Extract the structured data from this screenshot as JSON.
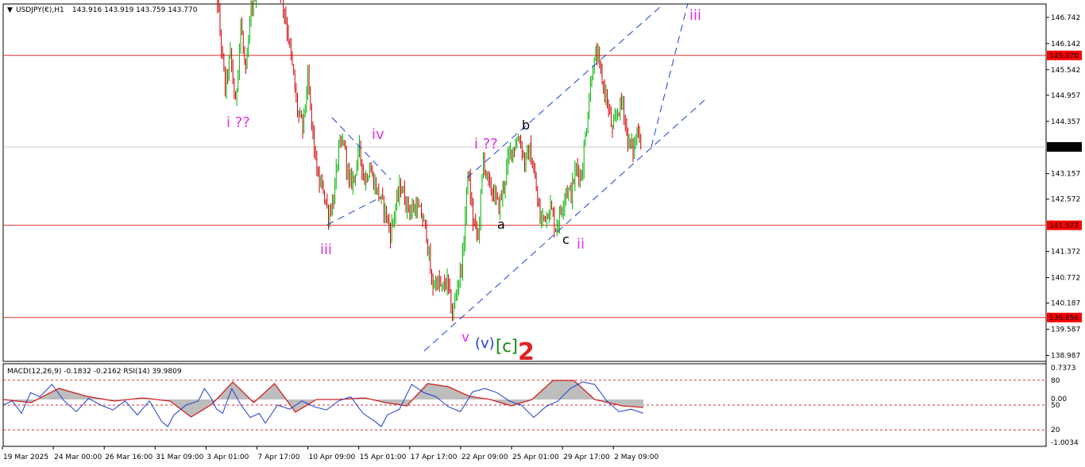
{
  "header": {
    "symbol": "USDJPY(€),H1",
    "ohlc": "143.916 143.919 143.759 143.770",
    "menu_glyph": "▼"
  },
  "indicator_header": "MACD(12,26,9) -0.1832 -0.2162  RSI(14) 39.9809",
  "colors": {
    "bull": "#00b300",
    "bear": "#cc0000",
    "level_line": "#e03030",
    "channel": "#1f3fcf",
    "wave_magenta": "#e030e0",
    "wave_black": "#000000",
    "wave_blue": "#1f3fcf",
    "wave_green": "#0a8a0a",
    "wave_red": "#e02020",
    "price_tag_bg": "#ff0000",
    "current_tag_bg": "#000000"
  },
  "chart_data": {
    "type": "candlestick",
    "ylim": [
      138.85,
      147.05
    ],
    "price_ticks": [
      "146.742",
      "146.142",
      "145.542",
      "144.957",
      "144.357",
      "143.157",
      "142.572",
      "141.372",
      "140.772",
      "140.187",
      "139.587",
      "138.987"
    ],
    "time_ticks": [
      "19 Mar 2025",
      "24 Mar 00:00",
      "26 Mar 16:00",
      "31 Mar 09:00",
      "3 Apr 01:00",
      "7 Apr 17:00",
      "10 Apr 09:00",
      "15 Apr 01:00",
      "17 Apr 17:00",
      "22 Apr 09:00",
      "25 Apr 01:00",
      "29 Apr 17:00",
      "2 May 09:00"
    ],
    "levels": [
      {
        "label": "145.870",
        "value": 145.87
      },
      {
        "label": "141.972",
        "value": 141.972
      },
      {
        "label": "139.856",
        "value": 139.856
      }
    ],
    "current_price": {
      "label": "143.770",
      "value": 143.77
    },
    "price_path": [
      [
        0,
        148.6
      ],
      [
        2,
        147.8
      ],
      [
        4,
        146.4
      ],
      [
        6,
        145.1
      ],
      [
        8,
        145.9
      ],
      [
        10,
        144.7
      ],
      [
        12,
        146.6
      ],
      [
        14,
        145.4
      ],
      [
        16,
        146.9
      ],
      [
        18,
        147.4
      ],
      [
        22,
        148.3
      ],
      [
        26,
        147.9
      ],
      [
        30,
        146.5
      ],
      [
        32,
        145.6
      ],
      [
        34,
        144.6
      ],
      [
        36,
        144.2
      ],
      [
        38,
        145.3
      ],
      [
        40,
        144.0
      ],
      [
        42,
        143.0
      ],
      [
        44,
        142.8
      ],
      [
        46,
        142.2
      ],
      [
        48,
        142.6
      ],
      [
        50,
        143.7
      ],
      [
        52,
        143.9
      ],
      [
        54,
        142.9
      ],
      [
        56,
        143.1
      ],
      [
        58,
        143.7
      ],
      [
        60,
        143.0
      ],
      [
        62,
        143.3
      ],
      [
        64,
        142.9
      ],
      [
        66,
        142.6
      ],
      [
        68,
        142.3
      ],
      [
        70,
        141.8
      ],
      [
        72,
        142.4
      ],
      [
        74,
        142.9
      ],
      [
        76,
        142.5
      ],
      [
        78,
        142.3
      ],
      [
        80,
        142.4
      ],
      [
        82,
        142.2
      ],
      [
        84,
        141.8
      ],
      [
        86,
        140.6
      ],
      [
        88,
        140.7
      ],
      [
        90,
        140.5
      ],
      [
        92,
        140.7
      ],
      [
        94,
        139.9
      ],
      [
        96,
        140.6
      ],
      [
        98,
        141.2
      ],
      [
        100,
        143.2
      ],
      [
        102,
        142.1
      ],
      [
        104,
        141.7
      ],
      [
        106,
        143.5
      ],
      [
        108,
        142.9
      ],
      [
        110,
        142.7
      ],
      [
        112,
        142.4
      ],
      [
        114,
        142.9
      ],
      [
        116,
        143.6
      ],
      [
        118,
        143.8
      ],
      [
        120,
        144.0
      ],
      [
        122,
        143.4
      ],
      [
        124,
        143.7
      ],
      [
        126,
        143.0
      ],
      [
        128,
        142.1
      ],
      [
        130,
        142.2
      ],
      [
        132,
        142.4
      ],
      [
        134,
        141.9
      ],
      [
        136,
        142.3
      ],
      [
        138,
        142.8
      ],
      [
        140,
        142.7
      ],
      [
        142,
        143.3
      ],
      [
        144,
        143.1
      ],
      [
        146,
        144.3
      ],
      [
        148,
        145.5
      ],
      [
        150,
        145.9
      ],
      [
        152,
        145.3
      ],
      [
        154,
        144.8
      ],
      [
        156,
        144.1
      ],
      [
        158,
        144.6
      ],
      [
        160,
        144.8
      ],
      [
        162,
        143.9
      ],
      [
        164,
        143.7
      ],
      [
        166,
        144.2
      ],
      [
        168,
        143.77
      ]
    ],
    "indicators": {
      "macd_axis_labels": [
        "0.7373",
        "0.00",
        "-1.0034"
      ],
      "rsi_levels": [
        80,
        50,
        20
      ],
      "rsi_level_labels": [
        "80",
        "50",
        "20"
      ],
      "macd_path": [
        [
          0,
          0.0
        ],
        [
          8,
          -0.1
        ],
        [
          16,
          0.35
        ],
        [
          24,
          0.1
        ],
        [
          32,
          -0.05
        ],
        [
          40,
          0.05
        ],
        [
          48,
          -0.05
        ],
        [
          54,
          -0.55
        ],
        [
          60,
          -0.15
        ],
        [
          66,
          0.55
        ],
        [
          72,
          -0.1
        ],
        [
          78,
          0.5
        ],
        [
          84,
          -0.4
        ],
        [
          90,
          0.0
        ],
        [
          96,
          0.0
        ],
        [
          104,
          0.05
        ],
        [
          110,
          -0.1
        ],
        [
          116,
          -0.2
        ],
        [
          122,
          0.5
        ],
        [
          128,
          0.4
        ],
        [
          134,
          0.1
        ],
        [
          140,
          0.0
        ],
        [
          146,
          -0.2
        ],
        [
          152,
          0.0
        ],
        [
          158,
          0.6
        ],
        [
          164,
          0.6
        ],
        [
          170,
          0.0
        ],
        [
          178,
          -0.2
        ],
        [
          184,
          -0.25
        ]
      ],
      "rsi_path": [
        [
          0,
          50
        ],
        [
          3,
          55
        ],
        [
          6,
          40
        ],
        [
          9,
          65
        ],
        [
          12,
          60
        ],
        [
          16,
          75
        ],
        [
          20,
          55
        ],
        [
          24,
          42
        ],
        [
          28,
          58
        ],
        [
          32,
          50
        ],
        [
          36,
          44
        ],
        [
          40,
          55
        ],
        [
          44,
          38
        ],
        [
          48,
          55
        ],
        [
          52,
          30
        ],
        [
          54,
          24
        ],
        [
          56,
          38
        ],
        [
          60,
          50
        ],
        [
          64,
          55
        ],
        [
          66,
          70
        ],
        [
          68,
          60
        ],
        [
          70,
          45
        ],
        [
          72,
          40
        ],
        [
          75,
          70
        ],
        [
          78,
          50
        ],
        [
          81,
          35
        ],
        [
          84,
          40
        ],
        [
          86,
          28
        ],
        [
          90,
          50
        ],
        [
          94,
          45
        ],
        [
          98,
          55
        ],
        [
          102,
          48
        ],
        [
          106,
          44
        ],
        [
          110,
          55
        ],
        [
          114,
          60
        ],
        [
          118,
          40
        ],
        [
          122,
          30
        ],
        [
          124,
          24
        ],
        [
          126,
          38
        ],
        [
          130,
          45
        ],
        [
          134,
          75
        ],
        [
          138,
          65
        ],
        [
          142,
          60
        ],
        [
          146,
          48
        ],
        [
          150,
          42
        ],
        [
          154,
          66
        ],
        [
          158,
          70
        ],
        [
          162,
          65
        ],
        [
          166,
          55
        ],
        [
          170,
          50
        ],
        [
          174,
          35
        ],
        [
          178,
          48
        ],
        [
          182,
          55
        ],
        [
          186,
          70
        ],
        [
          190,
          78
        ],
        [
          194,
          75
        ],
        [
          198,
          55
        ],
        [
          202,
          42
        ],
        [
          206,
          45
        ],
        [
          210,
          40
        ]
      ]
    },
    "annotations": [
      {
        "text": "i ??",
        "color": "wave_magenta"
      },
      {
        "text": "iv",
        "color": "wave_magenta"
      },
      {
        "text": "iii",
        "color": "wave_magenta"
      },
      {
        "text": "i ??",
        "color": "wave_magenta"
      },
      {
        "text": "b",
        "color": "wave_black"
      },
      {
        "text": "a",
        "color": "wave_black"
      },
      {
        "text": "c",
        "color": "wave_black"
      },
      {
        "text": "ii",
        "color": "wave_magenta"
      },
      {
        "text": "iii",
        "color": "wave_magenta"
      },
      {
        "text": "v",
        "color": "wave_magenta"
      },
      {
        "text": "(v)",
        "color": "wave_blue"
      },
      {
        "text": "[c]",
        "color": "wave_green"
      },
      {
        "text": "2",
        "color": "wave_red"
      }
    ]
  }
}
